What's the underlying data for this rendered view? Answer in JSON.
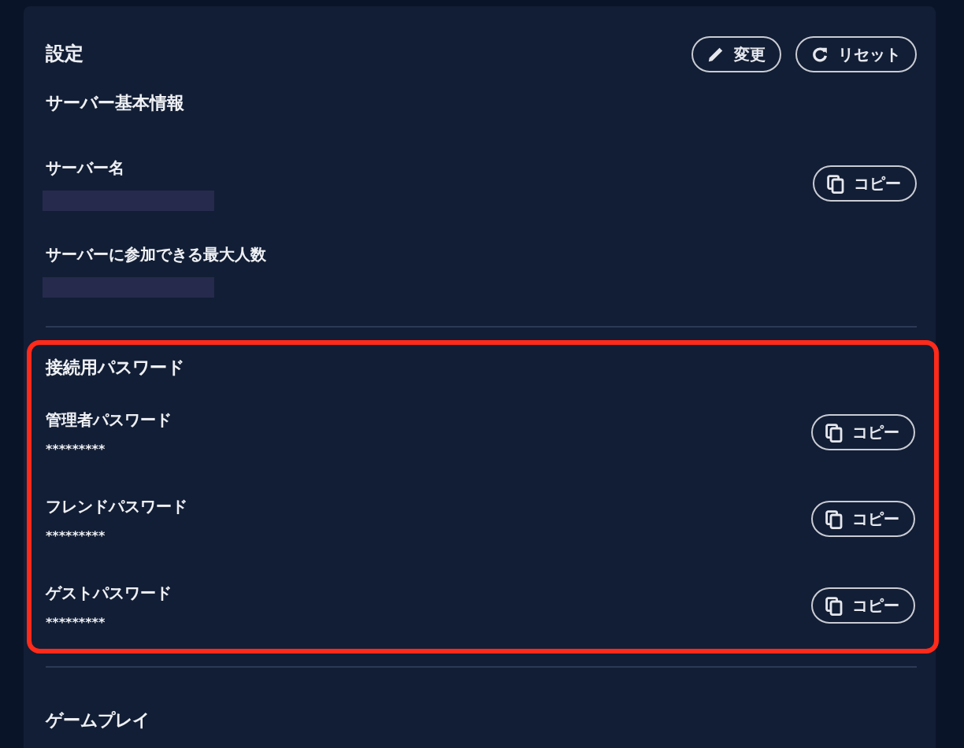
{
  "header": {
    "title": "設定",
    "buttons": [
      {
        "kind": "edit",
        "label": "変更"
      },
      {
        "kind": "reset",
        "label": "リセット"
      }
    ]
  },
  "sections": [
    {
      "title": "サーバー基本情報",
      "highlighted": false,
      "fields": [
        {
          "label": "サーバー名",
          "kind": "redacted",
          "copy": "コピー"
        },
        {
          "label": "サーバーに参加できる最大人数",
          "kind": "redacted"
        }
      ]
    },
    {
      "title": "接続用パスワード",
      "highlighted": true,
      "fields": [
        {
          "label": "管理者パスワード",
          "kind": "text",
          "value": "*********",
          "copy": "コピー"
        },
        {
          "label": "フレンドパスワード",
          "kind": "text",
          "value": "*********",
          "copy": "コピー"
        },
        {
          "label": "ゲストパスワード",
          "kind": "text",
          "value": "*********",
          "copy": "コピー"
        }
      ]
    },
    {
      "title": "ゲームプレイ",
      "highlighted": false
    }
  ]
}
